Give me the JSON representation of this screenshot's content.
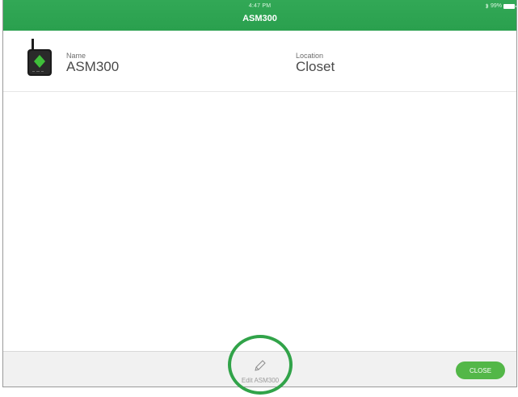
{
  "status_bar": {
    "time": "4:47 PM",
    "battery": "99%"
  },
  "nav": {
    "title": "ASM300"
  },
  "device": {
    "name_label": "Name",
    "name_value": "ASM300",
    "location_label": "Location",
    "location_value": "Closet",
    "image_icon": "gateway-device-icon"
  },
  "toolbar": {
    "edit_label": "Edit ASM300",
    "edit_icon": "pencil-icon",
    "close_label": "CLOSE"
  },
  "colors": {
    "header_green": "#2ea552",
    "button_green": "#53b748",
    "highlight_ring": "#31a349",
    "device_diamond": "#3fbf3a"
  }
}
